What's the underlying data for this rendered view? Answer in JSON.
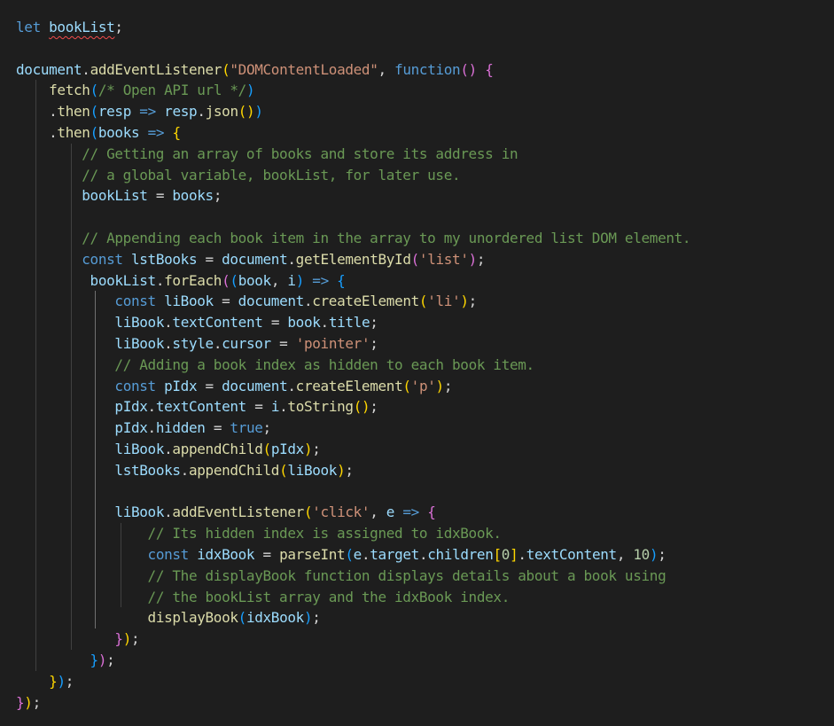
{
  "editor": {
    "theme": "dark",
    "colors": {
      "background": "#1e1e1e",
      "keyword": "#569cd6",
      "variable": "#9cdcfe",
      "function": "#dcdcaa",
      "string": "#ce9178",
      "comment": "#6a9955",
      "number": "#b5cea8",
      "punctuation": "#d4d4d4",
      "bracket_level_1": "#ffd700",
      "bracket_level_2": "#da70d6",
      "bracket_level_3": "#179fff",
      "error_squiggle": "#f14c4c"
    },
    "lines": [
      [
        [
          "let ",
          "keyword"
        ],
        [
          "bookList",
          "variable squiggle"
        ],
        [
          ";",
          "punct"
        ]
      ],
      [],
      [
        [
          "document",
          "variable"
        ],
        [
          ".",
          "punct"
        ],
        [
          "addEventListener",
          "function"
        ],
        [
          "(",
          "br1"
        ],
        [
          "\"DOMContentLoaded\"",
          "string"
        ],
        [
          ", ",
          "punct"
        ],
        [
          "function",
          "keyword"
        ],
        [
          "()",
          "br2"
        ],
        [
          " ",
          "punct"
        ],
        [
          "{",
          "br2"
        ]
      ],
      [
        [
          "    ",
          "punct"
        ],
        [
          "fetch",
          "function"
        ],
        [
          "(",
          "br3"
        ],
        [
          "/* Open API url */",
          "comment"
        ],
        [
          ")",
          "br3"
        ]
      ],
      [
        [
          "    .",
          "punct"
        ],
        [
          "then",
          "function"
        ],
        [
          "(",
          "br3"
        ],
        [
          "resp",
          "variable"
        ],
        [
          " ",
          "punct"
        ],
        [
          "=>",
          "keyword"
        ],
        [
          " ",
          "punct"
        ],
        [
          "resp",
          "variable"
        ],
        [
          ".",
          "punct"
        ],
        [
          "json",
          "function"
        ],
        [
          "()",
          "br1"
        ],
        [
          ")",
          "br3"
        ]
      ],
      [
        [
          "    .",
          "punct"
        ],
        [
          "then",
          "function"
        ],
        [
          "(",
          "br3"
        ],
        [
          "books",
          "variable"
        ],
        [
          " ",
          "punct"
        ],
        [
          "=>",
          "keyword"
        ],
        [
          " ",
          "punct"
        ],
        [
          "{",
          "br1"
        ]
      ],
      [
        [
          "        ",
          "punct"
        ],
        [
          "// Getting an array of books and store its address in",
          "comment"
        ]
      ],
      [
        [
          "        ",
          "punct"
        ],
        [
          "// a global variable, bookList, for later use.",
          "comment"
        ]
      ],
      [
        [
          "        ",
          "punct"
        ],
        [
          "bookList",
          "variable"
        ],
        [
          " = ",
          "punct"
        ],
        [
          "books",
          "variable"
        ],
        [
          ";",
          "punct"
        ]
      ],
      [],
      [
        [
          "        ",
          "punct"
        ],
        [
          "// Appending each book item in the array to my unordered list DOM element.",
          "comment"
        ]
      ],
      [
        [
          "        ",
          "punct"
        ],
        [
          "const ",
          "keyword"
        ],
        [
          "lstBooks",
          "variable"
        ],
        [
          " = ",
          "punct"
        ],
        [
          "document",
          "variable"
        ],
        [
          ".",
          "punct"
        ],
        [
          "getElementById",
          "function"
        ],
        [
          "(",
          "br2"
        ],
        [
          "'list'",
          "string"
        ],
        [
          ")",
          "br2"
        ],
        [
          ";",
          "punct"
        ]
      ],
      [
        [
          "         ",
          "punct"
        ],
        [
          "bookList",
          "variable"
        ],
        [
          ".",
          "punct"
        ],
        [
          "forEach",
          "function"
        ],
        [
          "(",
          "br2"
        ],
        [
          "(",
          "br3"
        ],
        [
          "book",
          "variable"
        ],
        [
          ", ",
          "punct"
        ],
        [
          "i",
          "variable"
        ],
        [
          ")",
          "br3"
        ],
        [
          " ",
          "punct"
        ],
        [
          "=>",
          "keyword"
        ],
        [
          " ",
          "punct"
        ],
        [
          "{",
          "br3"
        ]
      ],
      [
        [
          "            ",
          "punct"
        ],
        [
          "const ",
          "keyword"
        ],
        [
          "liBook",
          "variable"
        ],
        [
          " = ",
          "punct"
        ],
        [
          "document",
          "variable"
        ],
        [
          ".",
          "punct"
        ],
        [
          "createElement",
          "function"
        ],
        [
          "(",
          "br1"
        ],
        [
          "'li'",
          "string"
        ],
        [
          ")",
          "br1"
        ],
        [
          ";",
          "punct"
        ]
      ],
      [
        [
          "            ",
          "punct"
        ],
        [
          "liBook",
          "variable"
        ],
        [
          ".",
          "punct"
        ],
        [
          "textContent",
          "variable"
        ],
        [
          " = ",
          "punct"
        ],
        [
          "book",
          "variable"
        ],
        [
          ".",
          "punct"
        ],
        [
          "title",
          "variable"
        ],
        [
          ";",
          "punct"
        ]
      ],
      [
        [
          "            ",
          "punct"
        ],
        [
          "liBook",
          "variable"
        ],
        [
          ".",
          "punct"
        ],
        [
          "style",
          "variable"
        ],
        [
          ".",
          "punct"
        ],
        [
          "cursor",
          "variable"
        ],
        [
          " = ",
          "punct"
        ],
        [
          "'pointer'",
          "string"
        ],
        [
          ";",
          "punct"
        ]
      ],
      [
        [
          "            ",
          "punct"
        ],
        [
          "// Adding a book index as hidden to each book item.",
          "comment"
        ]
      ],
      [
        [
          "            ",
          "punct"
        ],
        [
          "const ",
          "keyword"
        ],
        [
          "pIdx",
          "variable"
        ],
        [
          " = ",
          "punct"
        ],
        [
          "document",
          "variable"
        ],
        [
          ".",
          "punct"
        ],
        [
          "createElement",
          "function"
        ],
        [
          "(",
          "br1"
        ],
        [
          "'p'",
          "string"
        ],
        [
          ")",
          "br1"
        ],
        [
          ";",
          "punct"
        ]
      ],
      [
        [
          "            ",
          "punct"
        ],
        [
          "pIdx",
          "variable"
        ],
        [
          ".",
          "punct"
        ],
        [
          "textContent",
          "variable"
        ],
        [
          " = ",
          "punct"
        ],
        [
          "i",
          "variable"
        ],
        [
          ".",
          "punct"
        ],
        [
          "toString",
          "function"
        ],
        [
          "()",
          "br1"
        ],
        [
          ";",
          "punct"
        ]
      ],
      [
        [
          "            ",
          "punct"
        ],
        [
          "pIdx",
          "variable"
        ],
        [
          ".",
          "punct"
        ],
        [
          "hidden",
          "variable"
        ],
        [
          " = ",
          "punct"
        ],
        [
          "true",
          "keyword"
        ],
        [
          ";",
          "punct"
        ]
      ],
      [
        [
          "            ",
          "punct"
        ],
        [
          "liBook",
          "variable"
        ],
        [
          ".",
          "punct"
        ],
        [
          "appendChild",
          "function"
        ],
        [
          "(",
          "br1"
        ],
        [
          "pIdx",
          "variable"
        ],
        [
          ")",
          "br1"
        ],
        [
          ";",
          "punct"
        ]
      ],
      [
        [
          "            ",
          "punct"
        ],
        [
          "lstBooks",
          "variable"
        ],
        [
          ".",
          "punct"
        ],
        [
          "appendChild",
          "function"
        ],
        [
          "(",
          "br1"
        ],
        [
          "liBook",
          "variable"
        ],
        [
          ")",
          "br1"
        ],
        [
          ";",
          "punct"
        ]
      ],
      [],
      [
        [
          "            ",
          "punct"
        ],
        [
          "liBook",
          "variable"
        ],
        [
          ".",
          "punct"
        ],
        [
          "addEventListener",
          "function"
        ],
        [
          "(",
          "br1"
        ],
        [
          "'click'",
          "string"
        ],
        [
          ", ",
          "punct"
        ],
        [
          "e",
          "variable"
        ],
        [
          " ",
          "punct"
        ],
        [
          "=>",
          "keyword"
        ],
        [
          " ",
          "punct"
        ],
        [
          "{",
          "br2"
        ]
      ],
      [
        [
          "                ",
          "punct"
        ],
        [
          "// Its hidden index is assigned to idxBook.",
          "comment"
        ]
      ],
      [
        [
          "                ",
          "punct"
        ],
        [
          "const ",
          "keyword"
        ],
        [
          "idxBook",
          "variable"
        ],
        [
          " = ",
          "punct"
        ],
        [
          "parseInt",
          "function"
        ],
        [
          "(",
          "br3"
        ],
        [
          "e",
          "variable"
        ],
        [
          ".",
          "punct"
        ],
        [
          "target",
          "variable"
        ],
        [
          ".",
          "punct"
        ],
        [
          "children",
          "variable"
        ],
        [
          "[",
          "br1"
        ],
        [
          "0",
          "number"
        ],
        [
          "]",
          "br1"
        ],
        [
          ".",
          "punct"
        ],
        [
          "textContent",
          "variable"
        ],
        [
          ", ",
          "punct"
        ],
        [
          "10",
          "number"
        ],
        [
          ")",
          "br3"
        ],
        [
          ";",
          "punct"
        ]
      ],
      [
        [
          "                ",
          "punct"
        ],
        [
          "// The displayBook function displays details about a book using",
          "comment"
        ]
      ],
      [
        [
          "                ",
          "punct"
        ],
        [
          "// the bookList array and the idxBook index.",
          "comment"
        ]
      ],
      [
        [
          "                ",
          "punct"
        ],
        [
          "displayBook",
          "function"
        ],
        [
          "(",
          "br3"
        ],
        [
          "idxBook",
          "variable"
        ],
        [
          ")",
          "br3"
        ],
        [
          ";",
          "punct"
        ]
      ],
      [
        [
          "            ",
          "punct"
        ],
        [
          "}",
          "br2"
        ],
        [
          ")",
          "br1"
        ],
        [
          ";",
          "punct"
        ]
      ],
      [
        [
          "         ",
          "punct"
        ],
        [
          "}",
          "br3"
        ],
        [
          ")",
          "br2"
        ],
        [
          ";",
          "punct"
        ]
      ],
      [
        [
          "    ",
          "punct"
        ],
        [
          "}",
          "br1"
        ],
        [
          ")",
          "br3"
        ],
        [
          ";",
          "punct"
        ]
      ],
      [
        [
          "}",
          "br2"
        ],
        [
          ")",
          "br1"
        ],
        [
          ";",
          "punct"
        ]
      ]
    ]
  }
}
